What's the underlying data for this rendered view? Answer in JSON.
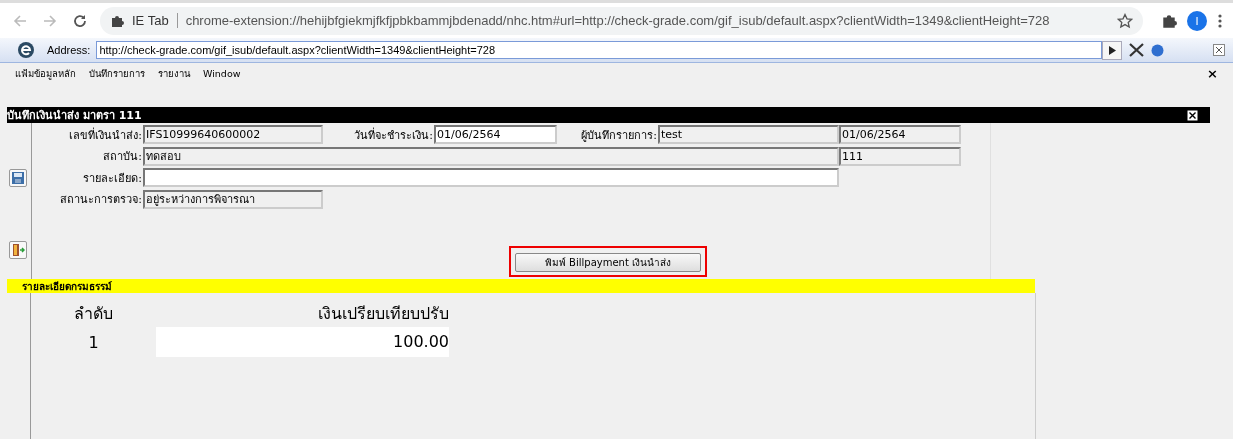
{
  "browser": {
    "chip": "IE Tab",
    "url": "chrome-extension://hehijbfgiekmjfkfjpbkbammjbdenadd/nhc.htm#url=http://check-grade.com/gif_isub/default.aspx?clientWidth=1349&clientHeight=728",
    "avatar": "I"
  },
  "address_bar": {
    "label": "Address:",
    "value": "http://check-grade.com/gif_isub/default.aspx?clientWidth=1349&clientHeight=728"
  },
  "menu": [
    "แฟ้มข้อมูลหลัก",
    "บันทึกรายการ",
    "รายงาน",
    "Window"
  ],
  "menu_close": "×",
  "form": {
    "title": "บันทึกเงินนำส่ง มาตรา 111",
    "doc_no": {
      "label": "เลขที่เงินนำส่ง:",
      "value": "IFS10999640600002"
    },
    "pay_date": {
      "label": "วันที่จะชำระเงิน:",
      "value": "01/06/2564"
    },
    "recorder": {
      "label": "ผู้บันทึกรายการ:",
      "value": "test"
    },
    "record_date": {
      "value": "01/06/2564"
    },
    "institute": {
      "label": "สถาบัน:",
      "value": "ทดสอบ"
    },
    "code": {
      "value": "111"
    },
    "detail": {
      "label": "รายละเอียด:"
    },
    "status": {
      "label": "สถานะการตรวจ:",
      "value": "อยู่ระหว่างการพิจารณา"
    },
    "print_button": "พิมพ์ Billpayment เงินนำส่ง"
  },
  "section": {
    "title": "รายละเอียดกรมธรรม์",
    "columns": [
      "ลำดับ",
      "เงินเปรียบเทียบปรับ"
    ],
    "rows": [
      [
        "1",
        "100.00"
      ]
    ]
  }
}
